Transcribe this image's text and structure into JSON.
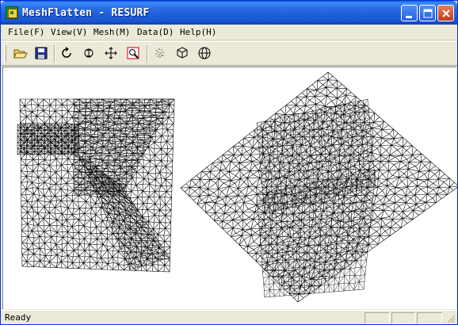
{
  "window": {
    "title": "MeshFlatten - RESURF"
  },
  "menubar": {
    "items": [
      {
        "label": "File(F)",
        "name": "menu-file"
      },
      {
        "label": "View(V)",
        "name": "menu-view"
      },
      {
        "label": "Mesh(M)",
        "name": "menu-mesh"
      },
      {
        "label": "Data(D)",
        "name": "menu-data"
      },
      {
        "label": "Help(H)",
        "name": "menu-help"
      }
    ]
  },
  "toolbar": {
    "buttons": [
      {
        "icon": "open-folder-icon"
      },
      {
        "icon": "save-disk-icon"
      },
      {
        "icon": "rotate-icon"
      },
      {
        "icon": "zoom-icon"
      },
      {
        "icon": "pan-move-icon"
      },
      {
        "icon": "zoom-window-icon"
      },
      {
        "icon": "point-cloud-icon"
      },
      {
        "icon": "cube-icon"
      },
      {
        "icon": "sphere-icon"
      }
    ]
  },
  "statusbar": {
    "text": "Ready"
  },
  "colors": {
    "titlebar": "#1e5ed9",
    "chrome": "#ece9d8",
    "mesh_line": "#000000",
    "canvas": "#ffffff",
    "close_button": "#c2391a"
  }
}
